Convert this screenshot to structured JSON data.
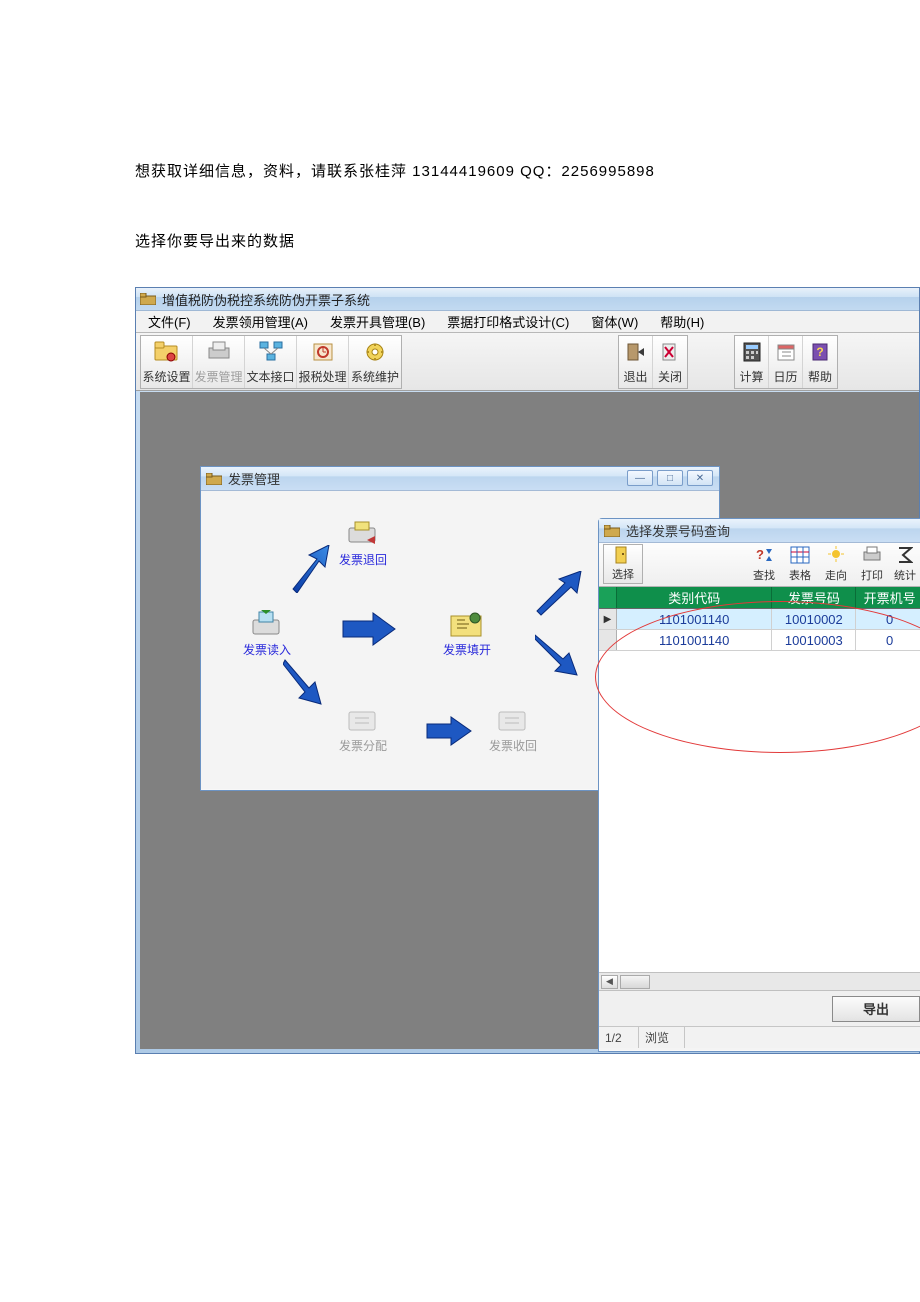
{
  "doc": {
    "line1": "想获取详细信息，资料，请联系张桂萍 13144419609  QQ：2256995898",
    "line2": "选择你要导出来的数据"
  },
  "app": {
    "title": "增值税防伪税控系统防伪开票子系统",
    "menus": {
      "file": "文件(F)",
      "recvmgr": "发票领用管理(A)",
      "issue": "发票开具管理(B)",
      "print": "票据打印格式设计(C)",
      "window": "窗体(W)",
      "help": "帮助(H)"
    },
    "toolbar": {
      "sys": "系统设置",
      "fpgl": "发票管理",
      "text": "文本接口",
      "tax": "报税处理",
      "maint": "系统维护",
      "exit": "退出",
      "close": "关闭",
      "calc": "计算",
      "cal": "日历",
      "help": "帮助"
    }
  },
  "fgl": {
    "title": "发票管理",
    "nodes": {
      "return": "发票退回",
      "read": "发票读入",
      "fill": "发票填开",
      "assign": "发票分配",
      "recall": "发票收回"
    }
  },
  "query": {
    "title": "选择发票号码查询",
    "toolbar": {
      "select": "选择",
      "find": "查找",
      "table": "表格",
      "go": "走向",
      "print": "打印",
      "stat": "统计"
    },
    "headers": {
      "code": "类别代码",
      "num": "发票号码",
      "machine": "开票机号"
    },
    "rows": [
      {
        "code": "1101001140",
        "num": "10010002",
        "machine": "0"
      },
      {
        "code": "1101001140",
        "num": "10010003",
        "machine": "0"
      }
    ],
    "export": "导出",
    "status_page": "1/2",
    "status_mode": "浏览"
  }
}
